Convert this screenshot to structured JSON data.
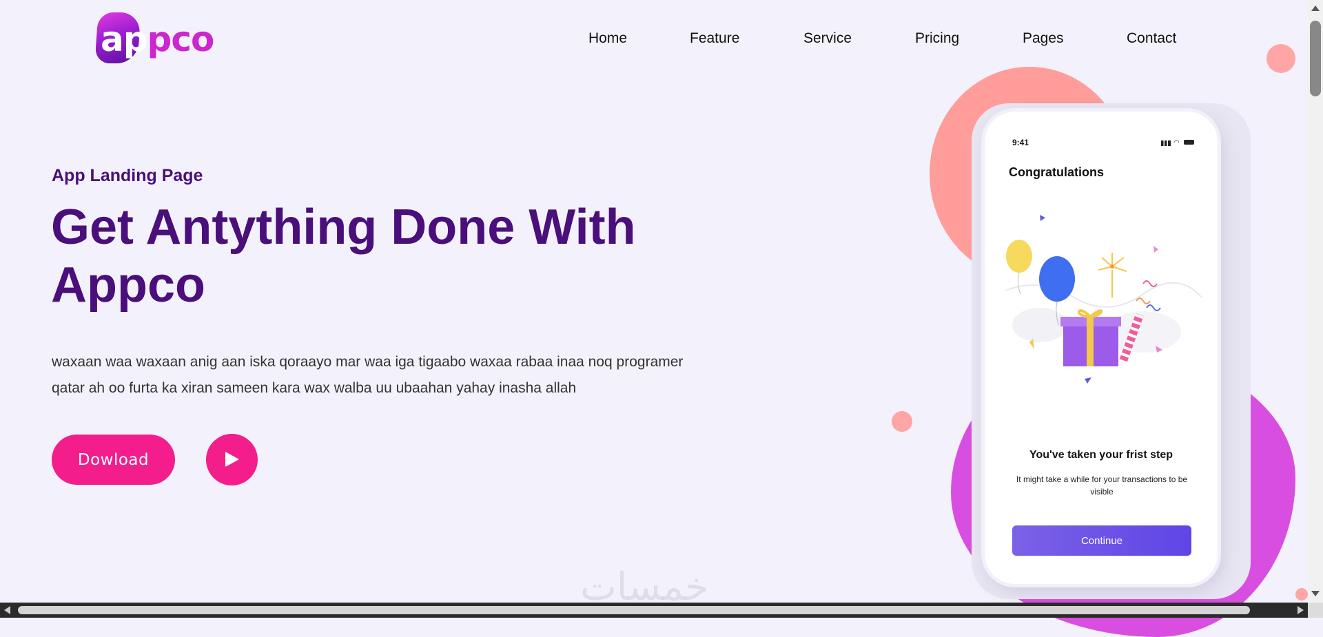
{
  "brand": {
    "logo_first": "ap",
    "logo_rest": "pco"
  },
  "nav": {
    "items": [
      {
        "label": "Home"
      },
      {
        "label": "Feature"
      },
      {
        "label": "Service"
      },
      {
        "label": "Pricing"
      },
      {
        "label": "Pages"
      },
      {
        "label": "Contact"
      }
    ]
  },
  "hero": {
    "eyebrow": "App Landing Page",
    "headline_line1": "Get Antything Done With",
    "headline_line2": "Appco",
    "paragraph": "waxaan waa waxaan anig aan iska qoraayo mar waa iga tigaabo waxaa rabaa inaa noq programer qatar ah oo furta ka xiran sameen kara wax walba uu ubaahan yahay inasha allah",
    "download_label": "Dowload",
    "play_icon": "play-icon"
  },
  "phone": {
    "time": "9:41",
    "title": "Congratulations",
    "step_title": "You've taken your frist step",
    "step_subtitle": "It might take a while for your transactions to be visible",
    "continue_label": "Continue"
  },
  "watermark": "خمسات",
  "colors": {
    "brand_purple": "#4a0f7a",
    "accent_pink": "#f31d8c",
    "background": "#f3f2fc",
    "blob_salmon": "#fe9d9a",
    "blob_purple": "#d84ee1",
    "button_violet": "#6b50e8"
  }
}
